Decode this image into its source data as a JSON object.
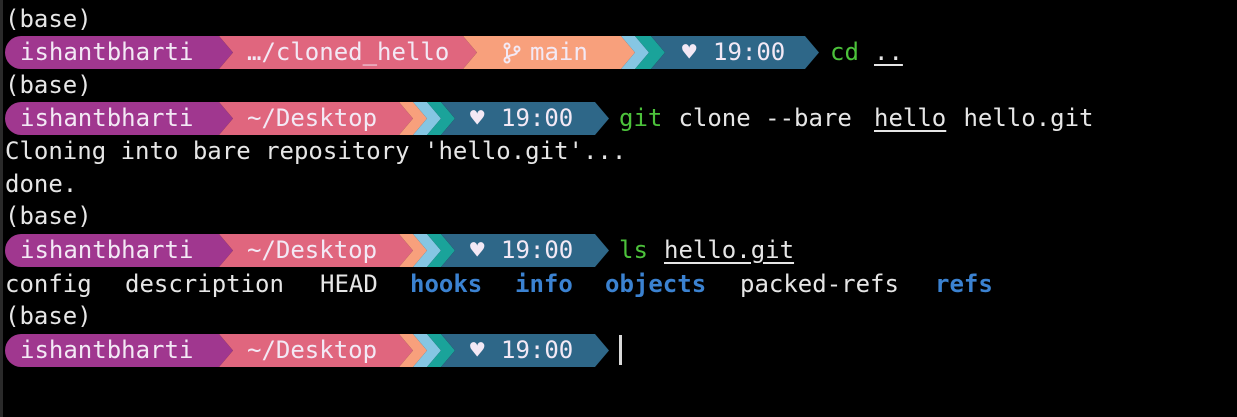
{
  "env": "(base)",
  "user": "ishantbharti",
  "branch_icon": "git-branch-icon",
  "heart": "♥",
  "time": "19:00",
  "prompts": [
    {
      "path": "…/cloned_hello",
      "branch": "main"
    },
    {
      "path": "~/Desktop"
    },
    {
      "path": "~/Desktop"
    },
    {
      "path": "~/Desktop"
    }
  ],
  "commands": {
    "c1": {
      "bin": "cd",
      "arg1": ".."
    },
    "c2": {
      "bin": "git",
      "rest1": " clone --bare ",
      "arg1": "hello",
      "rest2": " hello.git"
    },
    "c3": {
      "bin": "ls",
      "arg1": "hello.git"
    }
  },
  "output": {
    "clone_line1": "Cloning into bare repository 'hello.git'...",
    "clone_line2": "done.",
    "ls_items": [
      {
        "name": "config",
        "type": "file"
      },
      {
        "name": "description",
        "type": "file"
      },
      {
        "name": "HEAD",
        "type": "file"
      },
      {
        "name": "hooks",
        "type": "dir"
      },
      {
        "name": "info",
        "type": "dir"
      },
      {
        "name": "objects",
        "type": "dir"
      },
      {
        "name": "packed-refs",
        "type": "file"
      },
      {
        "name": "refs",
        "type": "dir"
      }
    ]
  },
  "colors": {
    "seg_user": "#a0378f",
    "seg_path": "#e0667e",
    "seg_branch": "#f8a07c",
    "seg_time": "#2e6788",
    "accent_light": "#86c6e3",
    "accent_teal": "#1aa39a",
    "dir_blue": "#3b82d1",
    "cmd_green": "#4cc23b"
  }
}
